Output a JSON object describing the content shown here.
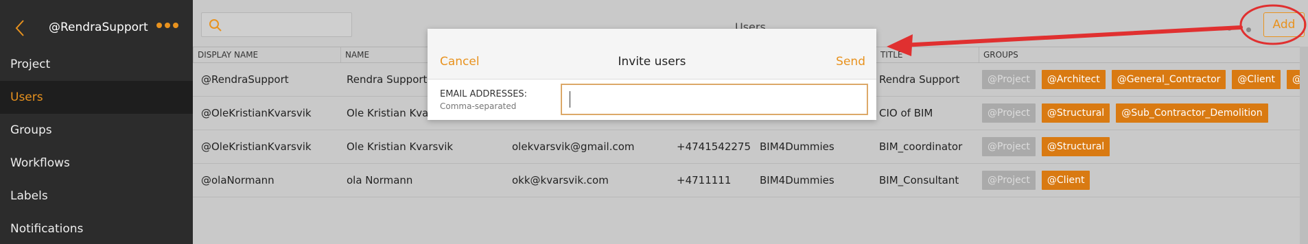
{
  "sidebar": {
    "title": "@RendraSupport",
    "items": [
      {
        "label": "Project"
      },
      {
        "label": "Users"
      },
      {
        "label": "Groups"
      },
      {
        "label": "Workflows"
      },
      {
        "label": "Labels"
      },
      {
        "label": "Notifications"
      }
    ],
    "accent": "#e8921e"
  },
  "header": {
    "title": "Users",
    "add_label": "Add",
    "search_placeholder": ""
  },
  "table": {
    "columns": [
      "DISPLAY NAME",
      "NAME",
      "",
      "",
      "",
      "TITLE",
      "GROUPS"
    ],
    "rows": [
      {
        "display": "@RendraSupport",
        "name": "Rendra Support",
        "email": "",
        "phone": "",
        "company": "",
        "title": "Rendra Support",
        "groups": [
          "@Project",
          "@Architect",
          "@General_Contractor",
          "@Client",
          "@"
        ]
      },
      {
        "display": "@OleKristianKvarsvik",
        "name": "Ole Kristian Kvars",
        "email": "",
        "phone": "",
        "company": "",
        "title": "CIO of BIM",
        "groups": [
          "@Project",
          "@Structural",
          "@Sub_Contractor_Demolition"
        ]
      },
      {
        "display": "@OleKristianKvarsvik",
        "name": "Ole Kristian Kvarsvik",
        "email": "olekvarsvik@gmail.com",
        "phone": "+4741542275",
        "company": "BIM4Dummies",
        "title": "BIM_coordinator",
        "groups": [
          "@Project",
          "@Structural"
        ]
      },
      {
        "display": "@olaNormann",
        "name": "ola Normann",
        "email": "okk@kvarsvik.com",
        "phone": "+4711111",
        "company": "BIM4Dummies",
        "title": "BIM_Consultant",
        "groups": [
          "@Project",
          "@Client"
        ]
      }
    ]
  },
  "modal": {
    "cancel": "Cancel",
    "title": "Invite users",
    "send": "Send",
    "email_label": "EMAIL ADDRESSES:",
    "email_hint": "Comma-separated",
    "email_value": ""
  },
  "colors": {
    "accent": "#e8921e",
    "tag": "#d97a12",
    "annotation": "#e03030"
  }
}
